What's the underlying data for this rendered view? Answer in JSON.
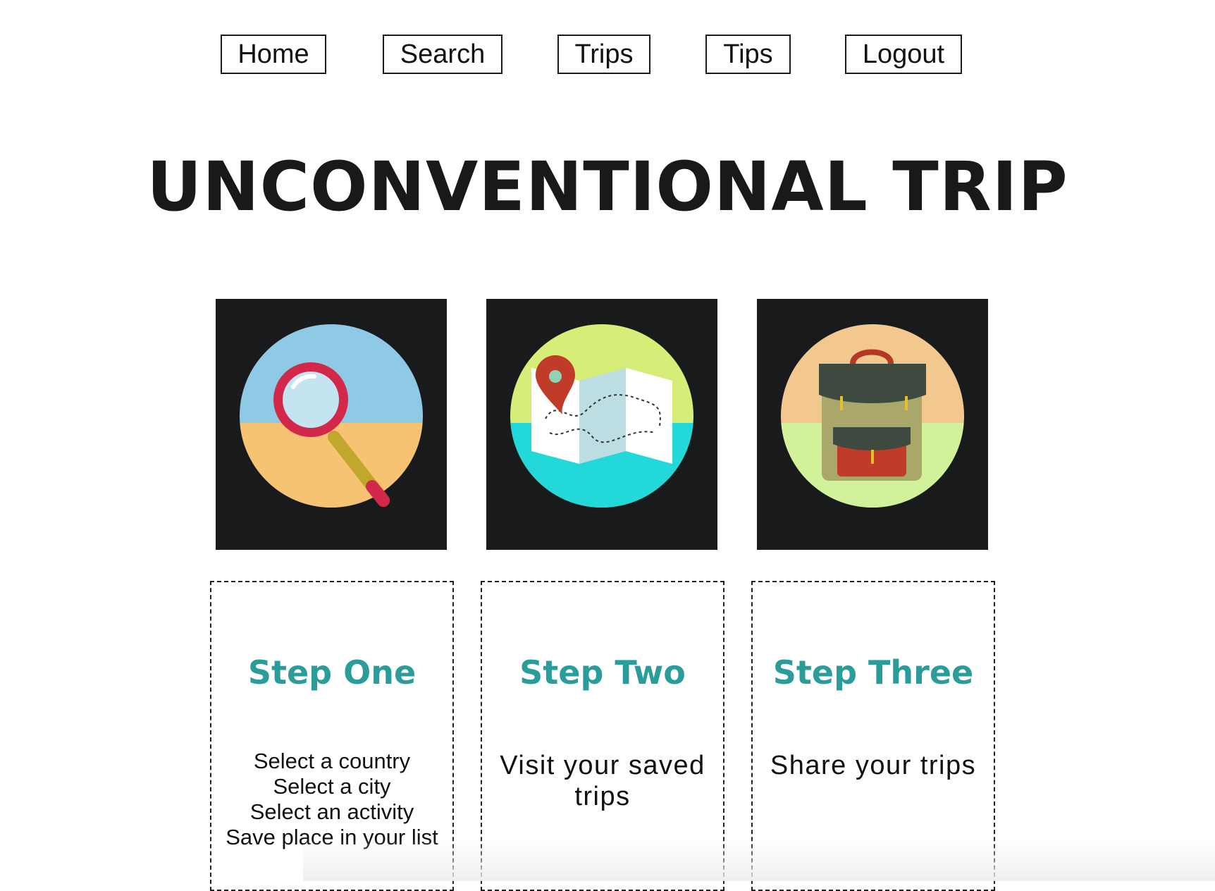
{
  "nav": {
    "items": [
      {
        "label": "Home"
      },
      {
        "label": "Search"
      },
      {
        "label": "Trips"
      },
      {
        "label": "Tips"
      },
      {
        "label": "Logout"
      }
    ]
  },
  "hero": {
    "title": "UNCONVENTIONAL TRIP"
  },
  "tiles": [
    {
      "icon": "magnifying-glass-icon"
    },
    {
      "icon": "map-pin-icon"
    },
    {
      "icon": "backpack-icon"
    }
  ],
  "steps": [
    {
      "title": "Step One",
      "lines": [
        "Select a country",
        "Select a city",
        "Select an activity",
        "Save place in your list"
      ]
    },
    {
      "title": "Step Two",
      "text": "Visit your saved trips"
    },
    {
      "title": "Step Three",
      "text": "Share your trips"
    }
  ],
  "colors": {
    "accent": "#2a9d9b",
    "tile_bg": "#181a1c"
  }
}
